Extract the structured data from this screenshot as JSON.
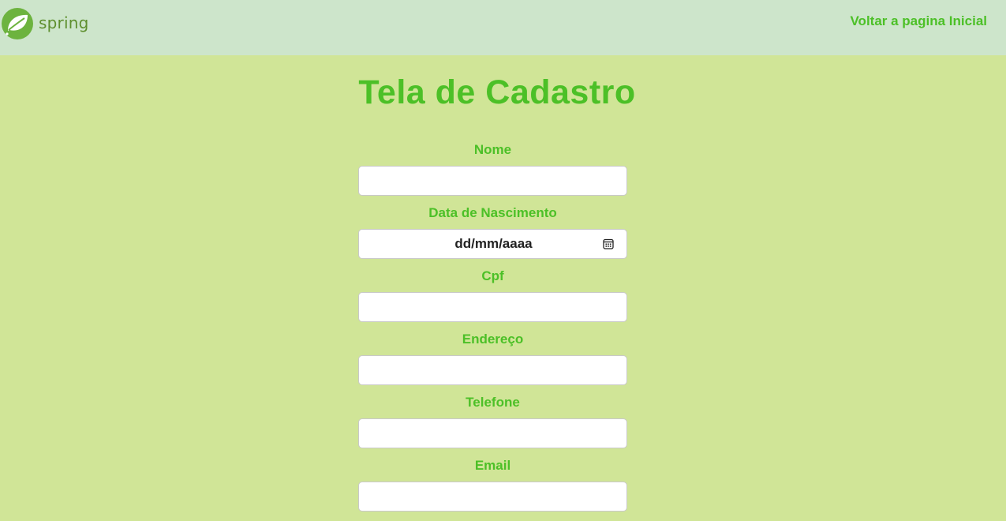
{
  "header": {
    "logo_text": "spring",
    "back_link": "Voltar a pagina Inicial"
  },
  "title": "Tela de Cadastro",
  "form": {
    "fields": [
      {
        "label": "Nome",
        "value": ""
      },
      {
        "label": "Data de Nascimento",
        "placeholder": "dd/mm/aaaa"
      },
      {
        "label": "Cpf",
        "value": ""
      },
      {
        "label": "Endereço",
        "value": ""
      },
      {
        "label": "Telefone",
        "value": ""
      },
      {
        "label": "Email",
        "value": ""
      }
    ]
  },
  "colors": {
    "page_background": "#d0e597",
    "header_background": "#cde5cb",
    "accent_green": "#4cc027",
    "logo_green": "#6db33f"
  },
  "icons": {
    "logo": "spring-leaf-icon",
    "date_picker": "calendar-icon"
  }
}
